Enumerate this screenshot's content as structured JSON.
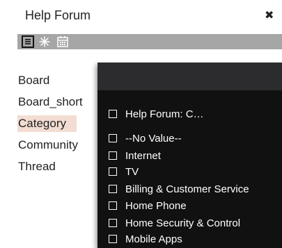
{
  "header": {
    "title": "Help Forum",
    "close_glyph": "✖"
  },
  "toolbar": {
    "icons": [
      "list-icon",
      "snowflake-icon",
      "calendar-icon"
    ]
  },
  "nav": {
    "items": [
      {
        "label": "Board"
      },
      {
        "label": "Board_short"
      },
      {
        "label": "Category",
        "selected": true
      },
      {
        "label": "Community"
      },
      {
        "label": "Thread"
      }
    ]
  },
  "dropdown": {
    "options": [
      {
        "label": "Help Forum: C…"
      },
      {
        "label": "--No Value--"
      },
      {
        "label": "Internet"
      },
      {
        "label": "TV"
      },
      {
        "label": "Billing & Customer Service"
      },
      {
        "label": "Home Phone"
      },
      {
        "label": "Home Security & Control"
      },
      {
        "label": "Mobile Apps"
      }
    ]
  },
  "colors": {
    "selected_bg": "#f3ddd2",
    "toolbar_bg": "#a6a6a6",
    "dropdown_bg": "#111111"
  }
}
